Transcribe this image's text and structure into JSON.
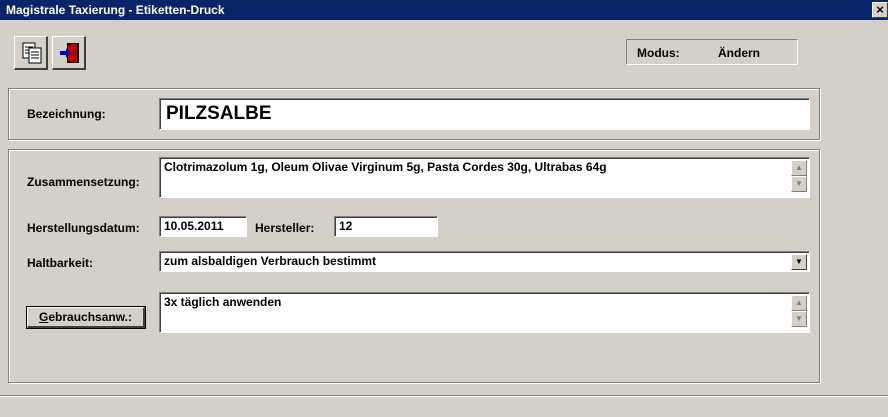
{
  "window": {
    "title": "Magistrale Taxierung - Etiketten-Druck",
    "close_glyph": "×"
  },
  "toolbar": {
    "buttons": [
      {
        "icon": "document-copy-icon"
      },
      {
        "icon": "exit-door-icon"
      }
    ]
  },
  "status": {
    "label": "Modus:",
    "value": "Ändern"
  },
  "form": {
    "bezeichnung_label": "Bezeichnung:",
    "bezeichnung_value": "PILZSALBE",
    "zusammensetzung_label": "Zusammensetzung:",
    "zusammensetzung_value": "Clotrimazolum 1g, Oleum Olivae Virginum 5g, Pasta Cordes 30g, Ultrabas 64g",
    "herstellungsdatum_label": "Herstellungsdatum:",
    "herstellungsdatum_value": "10.05.2011",
    "hersteller_label": "Hersteller:",
    "hersteller_value": "12",
    "haltbarkeit_label": "Haltbarkeit:",
    "haltbarkeit_value": "zum alsbaldigen Verbrauch bestimmt",
    "gebrauchsanw_button_first": "G",
    "gebrauchsanw_button_rest": "ebrauchsanw.:",
    "gebrauchsanw_value": "3x täglich anwenden"
  },
  "scroll": {
    "up": "▲",
    "down": "▼"
  }
}
